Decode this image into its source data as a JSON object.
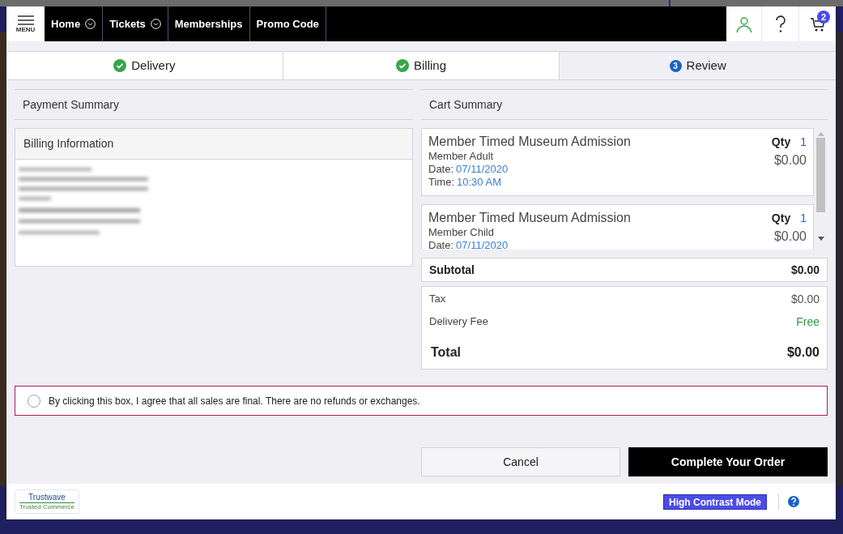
{
  "nav": {
    "menu_label": "MENU",
    "items": [
      {
        "label": "Home",
        "dropdown": true
      },
      {
        "label": "Tickets",
        "dropdown": true
      },
      {
        "label": "Memberships",
        "dropdown": false
      },
      {
        "label": "Promo Code",
        "dropdown": false
      }
    ],
    "cart_count": "2"
  },
  "steps": [
    {
      "label": "Delivery",
      "kind": "done",
      "selected": false
    },
    {
      "label": "Billing",
      "kind": "done",
      "selected": false
    },
    {
      "label": "Review",
      "kind": "current",
      "number": "3",
      "selected": true
    }
  ],
  "payment_summary": {
    "title": "Payment Summary",
    "billing_title": "Billing Information"
  },
  "cart": {
    "title": "Cart Summary",
    "items": [
      {
        "name": "Member Timed Museum Admission",
        "variant": "Member Adult",
        "date_label": "Date:",
        "date": "07/11/2020",
        "time_label": "Time:",
        "time": "10:30 AM",
        "qty_label": "Qty",
        "qty": "1",
        "price": "$0.00"
      },
      {
        "name": "Member Timed Museum Admission",
        "variant": "Member Child",
        "date_label": "Date:",
        "date": "07/11/2020",
        "qty_label": "Qty",
        "qty": "1",
        "price": "$0.00"
      }
    ],
    "subtotal_label": "Subtotal",
    "subtotal": "$0.00",
    "fees": [
      {
        "label": "Tax",
        "value": "$0.00",
        "free": false
      },
      {
        "label": "Delivery Fee",
        "value": "Free",
        "free": true
      }
    ],
    "total_label": "Total",
    "total": "$0.00"
  },
  "agreement": {
    "text": "By clicking this box, I agree that all sales are final. There are no refunds or exchanges.",
    "checked": false
  },
  "buttons": [
    {
      "label": "Cancel",
      "kind": "secondary"
    },
    {
      "label": "Complete Your Order",
      "kind": "primary"
    }
  ],
  "footer": {
    "trust_name": "Trustwave",
    "trust_sub": "Trusted Commerce",
    "high_contrast": "High Contrast Mode"
  }
}
